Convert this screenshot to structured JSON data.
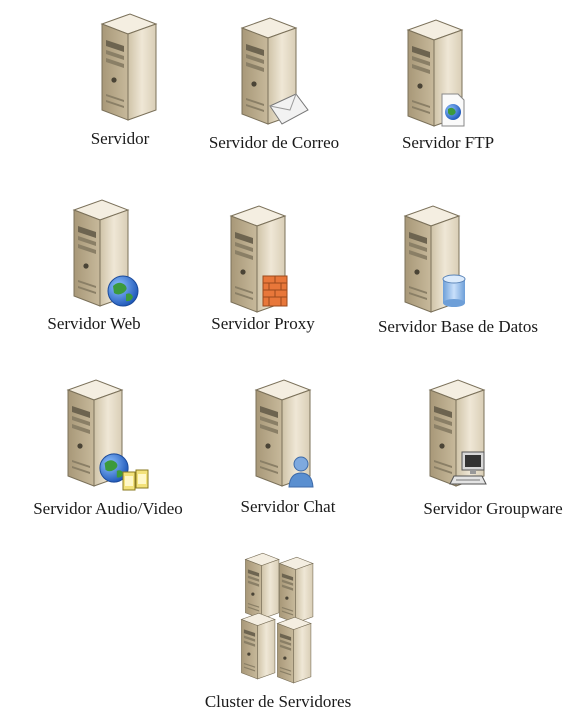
{
  "title": "",
  "servers": [
    {
      "label": "Servidor",
      "icon": "server-icon",
      "badge": "none"
    },
    {
      "label": "Servidor de Correo",
      "icon": "mail-server-icon",
      "badge": "envelope"
    },
    {
      "label": "Servidor FTP",
      "icon": "ftp-server-icon",
      "badge": "document-globe"
    },
    {
      "label": "Servidor Web",
      "icon": "web-server-icon",
      "badge": "globe"
    },
    {
      "label": "Servidor Proxy",
      "icon": "proxy-server-icon",
      "badge": "firewall"
    },
    {
      "label": "Servidor Base de Datos",
      "icon": "database-server-icon",
      "badge": "database-cylinder"
    },
    {
      "label": "Servidor Audio/Video",
      "icon": "audio-video-server-icon",
      "badge": "globe-film"
    },
    {
      "label": "Servidor Chat",
      "icon": "chat-server-icon",
      "badge": "user"
    },
    {
      "label": "Servidor Groupware",
      "icon": "groupware-server-icon",
      "badge": "computer"
    }
  ],
  "cluster": {
    "label": "Cluster de Servidores",
    "icon": "server-cluster-icon"
  },
  "colors": {
    "server_front": "#e6dcc6",
    "server_side": "#b9aa8c",
    "server_top": "#f3eee2",
    "outline": "#6f6650",
    "globe_blue": "#2c6fd2",
    "globe_green": "#3c9a3c",
    "firewall_orange": "#e8773a",
    "cylinder_blue": "#8fb7e6",
    "user_blue": "#5a8fd0",
    "label_text": "#1a1a1a"
  }
}
